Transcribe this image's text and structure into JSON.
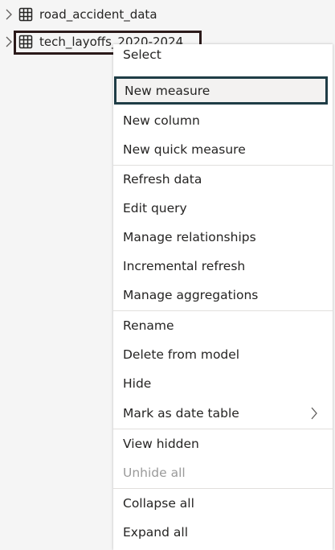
{
  "tables": [
    {
      "label": "road_accident_data"
    },
    {
      "label": "tech_layoffs_2020-2024"
    }
  ],
  "context_menu": {
    "items": [
      {
        "label": "Select"
      },
      {
        "label": "New measure"
      },
      {
        "label": "New column"
      },
      {
        "label": "New quick measure"
      },
      {
        "label": "Refresh data"
      },
      {
        "label": "Edit query"
      },
      {
        "label": "Manage relationships"
      },
      {
        "label": "Incremental refresh"
      },
      {
        "label": "Manage aggregations"
      },
      {
        "label": "Rename"
      },
      {
        "label": "Delete from model"
      },
      {
        "label": "Hide"
      },
      {
        "label": "Mark as date table"
      },
      {
        "label": "View hidden"
      },
      {
        "label": "Unhide all"
      },
      {
        "label": "Collapse all"
      },
      {
        "label": "Expand all"
      }
    ],
    "highlighted_item": "New measure",
    "disabled_item": "Unhide all"
  },
  "colors": {
    "highlight_border": "#1f3d46",
    "selection_border": "#2b1a1a",
    "disabled_text": "#9a9a9a"
  }
}
